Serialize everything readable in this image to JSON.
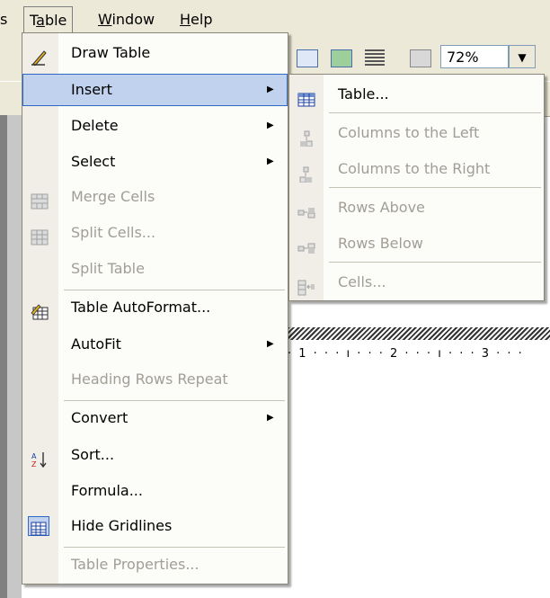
{
  "menubar": {
    "partial_left": "s",
    "table": "Table",
    "window": "Window",
    "help": "Help"
  },
  "toolbar": {
    "zoom_value": "72%"
  },
  "ruler": {
    "marks": "· 1 · · · ı · · · 2 · · · ı · · · 3 · · ·"
  },
  "table_menu": {
    "items": [
      {
        "label": "Draw Table",
        "icon": "pencil-icon",
        "enabled": true,
        "submenu": false
      },
      {
        "label": "Insert",
        "icon": "",
        "enabled": true,
        "submenu": true,
        "highlighted": true
      },
      {
        "label": "Delete",
        "icon": "",
        "enabled": true,
        "submenu": true
      },
      {
        "label": "Select",
        "icon": "",
        "enabled": true,
        "submenu": true
      },
      {
        "label": "Merge Cells",
        "icon": "merge-cells-icon",
        "enabled": false,
        "submenu": false
      },
      {
        "label": "Split Cells...",
        "icon": "split-cells-icon",
        "enabled": false,
        "submenu": false
      },
      {
        "label": "Split Table",
        "icon": "",
        "enabled": false,
        "submenu": false
      },
      {
        "label": "Table AutoFormat...",
        "icon": "autoformat-icon",
        "enabled": true,
        "submenu": false
      },
      {
        "label": "AutoFit",
        "icon": "",
        "enabled": true,
        "submenu": true
      },
      {
        "label": "Heading Rows Repeat",
        "icon": "",
        "enabled": false,
        "submenu": false
      },
      {
        "label": "Convert",
        "icon": "",
        "enabled": true,
        "submenu": true
      },
      {
        "label": "Sort...",
        "icon": "sort-az-icon",
        "enabled": true,
        "submenu": false
      },
      {
        "label": "Formula...",
        "icon": "",
        "enabled": true,
        "submenu": false
      },
      {
        "label": "Hide Gridlines",
        "icon": "gridlines-icon",
        "enabled": true,
        "submenu": false
      },
      {
        "label": "Table Properties...",
        "icon": "",
        "enabled": false,
        "submenu": false
      }
    ]
  },
  "insert_submenu": {
    "items": [
      {
        "label": "Table...",
        "icon": "insert-table-icon",
        "enabled": true
      },
      {
        "label": "Columns to the Left",
        "icon": "columns-left-icon",
        "enabled": false
      },
      {
        "label": "Columns to the Right",
        "icon": "columns-right-icon",
        "enabled": false
      },
      {
        "label": "Rows Above",
        "icon": "rows-above-icon",
        "enabled": false
      },
      {
        "label": "Rows Below",
        "icon": "rows-below-icon",
        "enabled": false
      },
      {
        "label": "Cells...",
        "icon": "insert-cells-icon",
        "enabled": false
      }
    ]
  },
  "colors": {
    "menu_bg": "#fcfcf9",
    "gutter": "#f0eee6",
    "highlight": "#c1d2ee",
    "highlight_border": "#316ac5",
    "disabled_text": "#a19e96",
    "chrome": "#ece9d8"
  }
}
